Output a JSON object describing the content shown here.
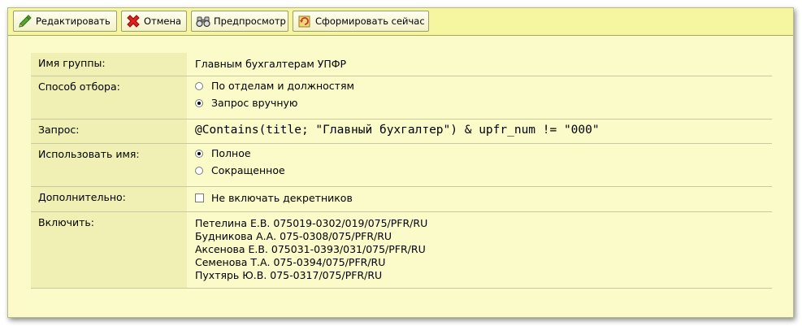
{
  "toolbar": {
    "edit_label": "Редактировать",
    "cancel_label": "Отмена",
    "preview_label": "Предпросмотр",
    "generate_label": "Сформировать сейчас",
    "edit_icon": "pencil-icon",
    "cancel_icon": "red-x-icon",
    "preview_icon": "binoculars-icon",
    "generate_icon": "refresh-icon"
  },
  "form": {
    "group_name": {
      "label": "Имя группы:",
      "value": "Главным бухгалтерам УПФР"
    },
    "selection": {
      "label": "Способ отбора:",
      "options": [
        {
          "text": "По отделам и должностям",
          "selected": false
        },
        {
          "text": "Запрос вручную",
          "selected": true
        }
      ]
    },
    "query": {
      "label": "Запрос:",
      "value": "@Contains(title; \"Главный бухгалтер\") & upfr_num != \"000\""
    },
    "use_name": {
      "label": "Использовать имя:",
      "options": [
        {
          "text": "Полное",
          "selected": true
        },
        {
          "text": "Сокращенное",
          "selected": false
        }
      ]
    },
    "additional": {
      "label": "Дополнительно:",
      "checkbox_text": "Не включать декретников",
      "checked": false
    },
    "include": {
      "label": "Включить:",
      "items": [
        "Петелина Е.В. 075019-0302/019/075/PFR/RU",
        "Будникова А.А. 075-0308/075/PFR/RU",
        "Аксенова Е.В. 075031-0393/031/075/PFR/RU",
        "Семенова Т.А. 075-0394/075/PFR/RU",
        "Пухтярь Ю.В. 075-0317/075/PFR/RU"
      ]
    }
  },
  "colors": {
    "panel_bg": "#fbfbc9",
    "toolbar_bg": "#f6f6a0",
    "label_bg": "#f0f0b4"
  }
}
